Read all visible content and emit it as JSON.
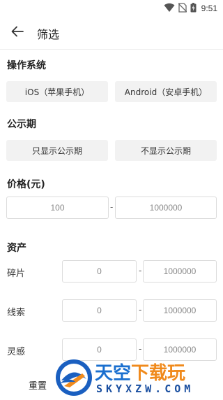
{
  "status_bar": {
    "time": "9:51"
  },
  "app_bar": {
    "title": "筛选"
  },
  "sections": {
    "os": {
      "title": "操作系统",
      "options": [
        "iOS（苹果手机）",
        "Android（安卓手机）"
      ]
    },
    "public": {
      "title": "公示期",
      "options": [
        "只显示公示期",
        "不显示公示期"
      ]
    },
    "price": {
      "title": "价格(元)",
      "min": "100",
      "separator": "-",
      "max": "1000000"
    },
    "assets": {
      "title": "资产",
      "rows": [
        {
          "label": "碎片",
          "min": "0",
          "separator": "-",
          "max": "1000000"
        },
        {
          "label": "线索",
          "min": "0",
          "separator": "-",
          "max": "1000000"
        },
        {
          "label": "灵感",
          "min": "0",
          "separator": "-",
          "max": "1000000"
        }
      ]
    }
  },
  "footer": {
    "reset_label": "重置"
  },
  "watermark": {
    "brand_part1": "天空",
    "brand_part2": "下载玩",
    "domain": "SKYXZW.COM"
  }
}
